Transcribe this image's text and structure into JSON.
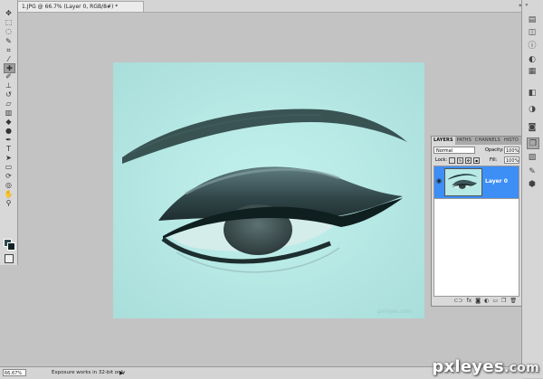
{
  "document": {
    "tab_title": "1.JPG @ 66.7% (Layer 0, RGB/8#) *",
    "close": "×"
  },
  "tools": [
    {
      "name": "move-tool-icon",
      "glyph": "✥"
    },
    {
      "name": "marquee-tool-icon",
      "glyph": "⬚"
    },
    {
      "name": "lasso-tool-icon",
      "glyph": "◌"
    },
    {
      "name": "quick-select-tool-icon",
      "glyph": "✎"
    },
    {
      "name": "crop-tool-icon",
      "glyph": "⌗"
    },
    {
      "name": "eyedropper-tool-icon",
      "glyph": "⁄"
    },
    {
      "name": "healing-brush-tool-icon",
      "glyph": "✚"
    },
    {
      "name": "brush-tool-icon",
      "glyph": "✐"
    },
    {
      "name": "clone-stamp-tool-icon",
      "glyph": "⊥"
    },
    {
      "name": "history-brush-tool-icon",
      "glyph": "↺"
    },
    {
      "name": "eraser-tool-icon",
      "glyph": "▱"
    },
    {
      "name": "gradient-tool-icon",
      "glyph": "▥"
    },
    {
      "name": "blur-tool-icon",
      "glyph": "◆"
    },
    {
      "name": "dodge-tool-icon",
      "glyph": "●"
    },
    {
      "name": "pen-tool-icon",
      "glyph": "✒"
    },
    {
      "name": "type-tool-icon",
      "glyph": "T"
    },
    {
      "name": "path-select-tool-icon",
      "glyph": "➤"
    },
    {
      "name": "shape-tool-icon",
      "glyph": "▭"
    },
    {
      "name": "3d-rotate-tool-icon",
      "glyph": "⟳"
    },
    {
      "name": "3d-orbit-tool-icon",
      "glyph": "◎"
    },
    {
      "name": "hand-tool-icon",
      "glyph": "✋"
    },
    {
      "name": "zoom-tool-icon",
      "glyph": "⚲"
    }
  ],
  "colors": {
    "foreground": "#2e4a4d",
    "background": "#0f2224",
    "highlight": "#3d8ef5"
  },
  "layers_panel": {
    "tabs": [
      "LAYERS",
      "PATHS",
      "CHANNELS",
      "HISTO"
    ],
    "blend_mode": "Normal",
    "opacity_label": "Opacity:",
    "opacity_value": "100%",
    "lock_label": "Lock:",
    "fill_label": "Fill:",
    "fill_value": "100%",
    "layers": [
      {
        "name": "Layer 0",
        "visible": true
      }
    ],
    "footer_icons": [
      "link-icon",
      "fx-icon",
      "mask-icon",
      "adjustment-icon",
      "folder-icon",
      "new-layer-icon",
      "trash-icon"
    ]
  },
  "dock_icons": [
    {
      "name": "histogram-icon",
      "glyph": "▤"
    },
    {
      "name": "navigator-icon",
      "glyph": "◫"
    },
    {
      "name": "info-icon",
      "glyph": "ⓘ"
    },
    {
      "name": "color-icon",
      "glyph": "◐"
    },
    {
      "name": "swatches-icon",
      "glyph": "▦"
    },
    {
      "name": "styles-icon",
      "glyph": "◧"
    },
    {
      "name": "adjustments-icon",
      "glyph": "◑"
    },
    {
      "name": "masks-icon",
      "glyph": "◙"
    },
    {
      "name": "layers-icon",
      "glyph": "❐"
    },
    {
      "name": "channels-icon",
      "glyph": "▨"
    },
    {
      "name": "paths-icon",
      "glyph": "✎"
    },
    {
      "name": "3d-icon",
      "glyph": "⬢"
    }
  ],
  "canvas": {
    "watermark": "pxleyes.com"
  },
  "status": {
    "zoom": "66.67%",
    "message": "Exposure works in 32-bit only",
    "arrow": "▶"
  },
  "logo": {
    "text": "pxleyes",
    "suffix": ".com"
  }
}
